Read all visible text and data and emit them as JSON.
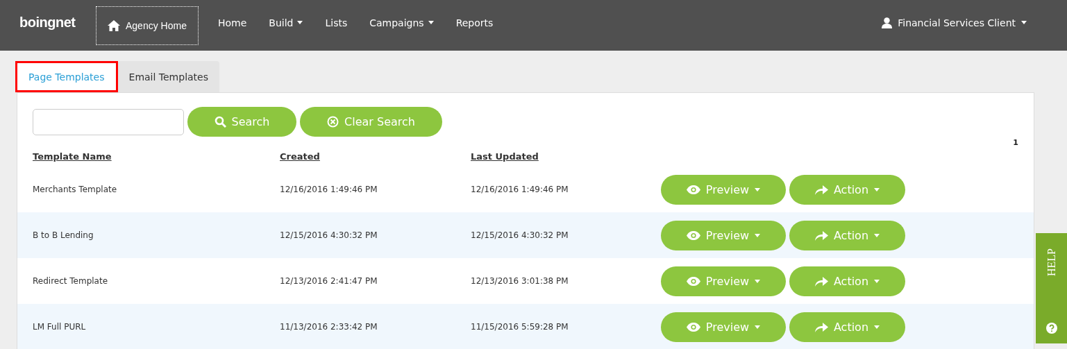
{
  "navbar": {
    "logo": "boingnet",
    "agency_home": "Agency Home",
    "items": [
      {
        "label": "Home",
        "dropdown": false
      },
      {
        "label": "Build",
        "dropdown": true
      },
      {
        "label": "Lists",
        "dropdown": false
      },
      {
        "label": "Campaigns",
        "dropdown": true
      },
      {
        "label": "Reports",
        "dropdown": false
      }
    ],
    "user": "Financial Services Client"
  },
  "tabs": [
    {
      "label": "Page Templates",
      "selected": true
    },
    {
      "label": "Email Templates",
      "selected": false
    }
  ],
  "search": {
    "search_button": "Search",
    "clear_button": "Clear Search"
  },
  "pagination": "1",
  "table": {
    "columns": [
      "Template Name",
      "Created",
      "Last Updated"
    ],
    "rows": [
      {
        "name": "Merchants Template",
        "created": "12/16/2016 1:49:46 PM",
        "updated": "12/16/2016 1:49:46 PM",
        "preview": "Preview",
        "action": "Action"
      },
      {
        "name": "B to B Lending",
        "created": "12/15/2016 4:30:32 PM",
        "updated": "12/15/2016 4:30:32 PM",
        "preview": "Preview",
        "action": "Action"
      },
      {
        "name": "Redirect Template",
        "created": "12/13/2016 2:41:47 PM",
        "updated": "12/13/2016 3:01:38 PM",
        "preview": "Preview",
        "action": "Action"
      },
      {
        "name": "LM Full PURL",
        "created": "11/13/2016 2:33:42 PM",
        "updated": "11/15/2016 5:59:28 PM",
        "preview": "Preview",
        "action": "Action"
      }
    ]
  },
  "help_tab": "HELP"
}
